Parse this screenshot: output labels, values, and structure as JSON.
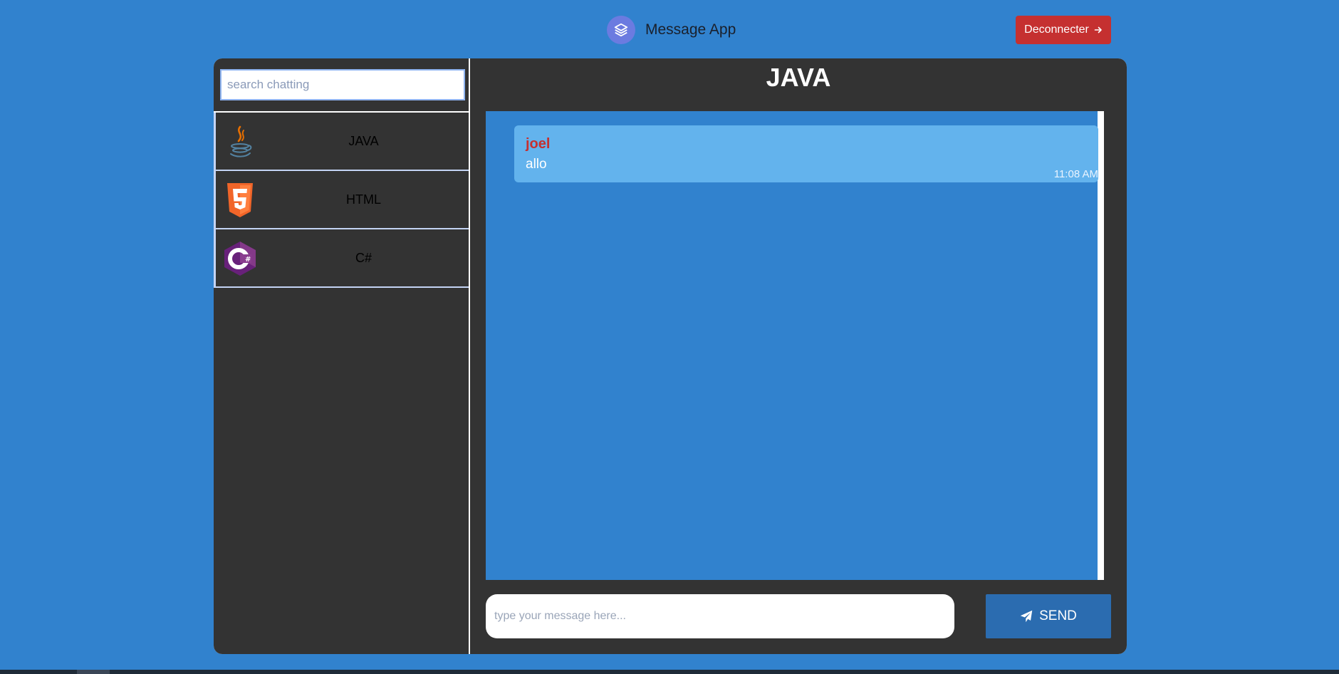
{
  "header": {
    "app_name": "Message App",
    "logo_icon": "layers-icon",
    "logout_label": "Deconnecter",
    "logout_icon": "arrow-right-icon"
  },
  "sidebar": {
    "search_placeholder": "search chatting",
    "items": [
      {
        "label": "JAVA",
        "icon": "java-icon"
      },
      {
        "label": "HTML",
        "icon": "html5-icon"
      },
      {
        "label": "C#",
        "icon": "csharp-icon"
      }
    ]
  },
  "chat": {
    "title": "JAVA",
    "messages": [
      {
        "sender": "joel",
        "text": "allo",
        "time": "11:08 AM"
      }
    ],
    "input_placeholder": "type your message here...",
    "send_label": "SEND",
    "send_icon": "paper-plane-icon"
  },
  "colors": {
    "background": "#3182ce",
    "panel": "#333333",
    "logout": "#c53030",
    "bubble": "#63b3ed",
    "sender": "#c53030",
    "send_button": "#2b6cb0"
  }
}
